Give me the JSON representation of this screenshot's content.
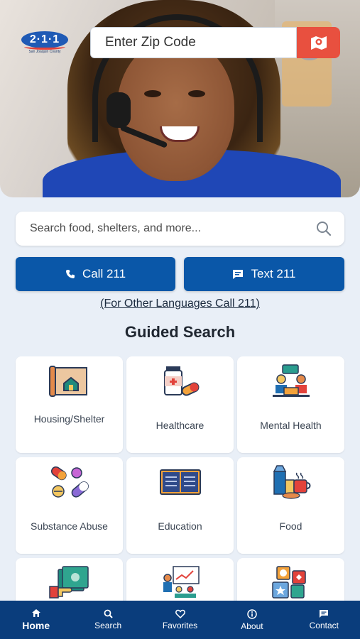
{
  "logo": {
    "text": "2·1·1",
    "tagline": "San Joaquin County"
  },
  "zip_search": {
    "placeholder": "Enter Zip Code",
    "icon": "map-pin-icon"
  },
  "search": {
    "placeholder": "Search food, shelters, and more...",
    "icon": "search-icon"
  },
  "actions": {
    "call_label": "Call 211",
    "text_label": "Text 211",
    "other_languages": "(For Other Languages Call 211)"
  },
  "guided_search": {
    "title": "Guided Search",
    "categories": [
      {
        "label": "Housing/Shelter",
        "icon": "house-blueprint-icon"
      },
      {
        "label": "Healthcare",
        "icon": "medicine-icon"
      },
      {
        "label": "Mental Health",
        "icon": "counseling-icon"
      },
      {
        "label": "Substance Abuse",
        "icon": "pills-icon"
      },
      {
        "label": "Education",
        "icon": "book-icon"
      },
      {
        "label": "Food",
        "icon": "groceries-icon"
      },
      {
        "label": "",
        "icon": "money-hand-icon"
      },
      {
        "label": "",
        "icon": "presentation-icon"
      },
      {
        "label": "",
        "icon": "puzzle-icon"
      }
    ]
  },
  "nav": {
    "items": [
      {
        "label": "Home",
        "icon": "home-icon"
      },
      {
        "label": "Search",
        "icon": "search-icon"
      },
      {
        "label": "Favorites",
        "icon": "heart-icon"
      },
      {
        "label": "About",
        "icon": "info-icon"
      },
      {
        "label": "Contact",
        "icon": "chat-icon"
      }
    ],
    "active": "Home"
  },
  "colors": {
    "primary": "#0a57a8",
    "nav_bg": "#0a3d7c",
    "accent": "#e8503f",
    "page_bg": "#e9eff7"
  }
}
